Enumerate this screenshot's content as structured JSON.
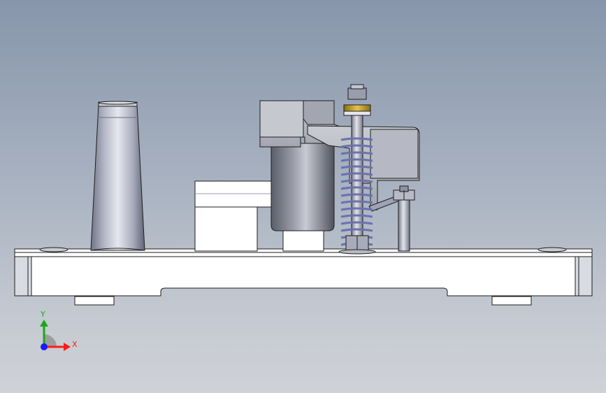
{
  "viewport": {
    "background_top": "#8796ab",
    "background_bottom": "#cfd2d7"
  },
  "model": {
    "body_color": "#ffffff",
    "outline_color": "#1e1e1e",
    "metal_color": "#9ea2b4",
    "spring_color": "#6a72b0",
    "washer_color": "#c9a227"
  },
  "triad": {
    "x_label": "X",
    "y_label": "Y",
    "x_color": "#ff1a1a",
    "y_color": "#1aa81a",
    "z_color": "#1a1aff"
  }
}
